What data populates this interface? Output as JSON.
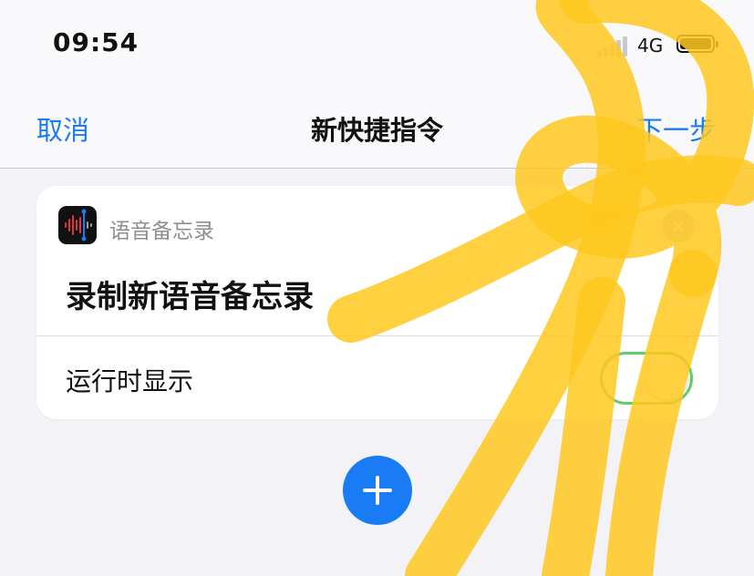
{
  "status_bar": {
    "time": "09:54",
    "network": "4G",
    "signal_icon": "signal-bars-icon",
    "battery_icon": "battery-icon"
  },
  "nav": {
    "cancel_label": "取消",
    "title": "新快捷指令",
    "next_label": "下一步"
  },
  "action_card": {
    "app_icon": "voice-memo-waveform-icon",
    "app_name": "语音备忘录",
    "action_title": "录制新语音备忘录",
    "remove_icon": "close-icon",
    "toggle_label": "运行时显示",
    "toggle_on": true
  },
  "add_action_icon": "plus-icon",
  "colors": {
    "accent": "#1a7cf5",
    "toggle_green": "#5ccf6b",
    "annotation_yellow": "#ffc81e",
    "background": "#f2f2f7"
  }
}
